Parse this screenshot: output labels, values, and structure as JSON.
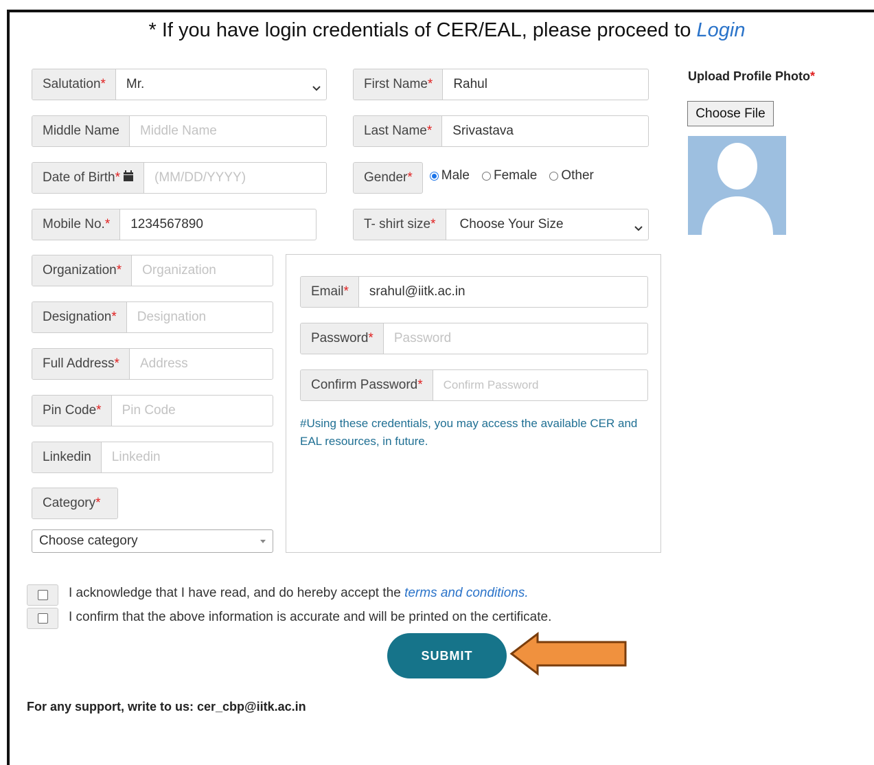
{
  "heading": {
    "prefix": "* If you have login credentials of CER/EAL, please proceed to",
    "link": "Login"
  },
  "salutation": {
    "label": "Salutation",
    "value": "Mr."
  },
  "first_name": {
    "label": "First Name",
    "value": "Rahul"
  },
  "middle_name": {
    "label": "Middle Name",
    "placeholder": "Middle Name"
  },
  "last_name": {
    "label": "Last Name",
    "value": "Srivastava"
  },
  "dob": {
    "label": "Date of Birth",
    "placeholder": "(MM/DD/YYYY)"
  },
  "gender": {
    "label": "Gender",
    "options": [
      "Male",
      "Female",
      "Other"
    ],
    "selected": "Male"
  },
  "mobile": {
    "label": "Mobile No.",
    "value": "1234567890"
  },
  "tshirt": {
    "label": "T- shirt size",
    "value": "Choose Your Size"
  },
  "organization": {
    "label": "Organization",
    "placeholder": "Organization"
  },
  "designation": {
    "label": "Designation",
    "placeholder": "Designation"
  },
  "address": {
    "label": "Full Address",
    "placeholder": "Address"
  },
  "pincode": {
    "label": "Pin Code",
    "placeholder": "Pin Code"
  },
  "linkedin": {
    "label": "Linkedin",
    "placeholder": "Linkedin"
  },
  "category": {
    "label": "Category",
    "value": "Choose category"
  },
  "email": {
    "label": "Email",
    "value": "srahul@iitk.ac.in"
  },
  "password": {
    "label": "Password",
    "placeholder": "Password"
  },
  "confirm_password": {
    "label": "Confirm Password",
    "placeholder": "Confirm Password"
  },
  "credentials_note": "#Using these credentials, you may access the available CER and EAL resources, in future.",
  "upload": {
    "title": "Upload Profile Photo",
    "button": "Choose File"
  },
  "ack1": {
    "text": "I acknowledge that I have read, and do hereby accept the",
    "link": "terms and conditions."
  },
  "ack2": {
    "text": "I confirm that the above information is accurate and will be printed on the certificate."
  },
  "submit_label": "SUBMIT",
  "support": "For any support, write to us: cer_cbp@iitk.ac.in",
  "colors": {
    "accent": "#16748a",
    "link": "#2a73c9",
    "required": "#e02020",
    "arrow_fill": "#f0913e",
    "arrow_stroke": "#7a3d0c"
  }
}
